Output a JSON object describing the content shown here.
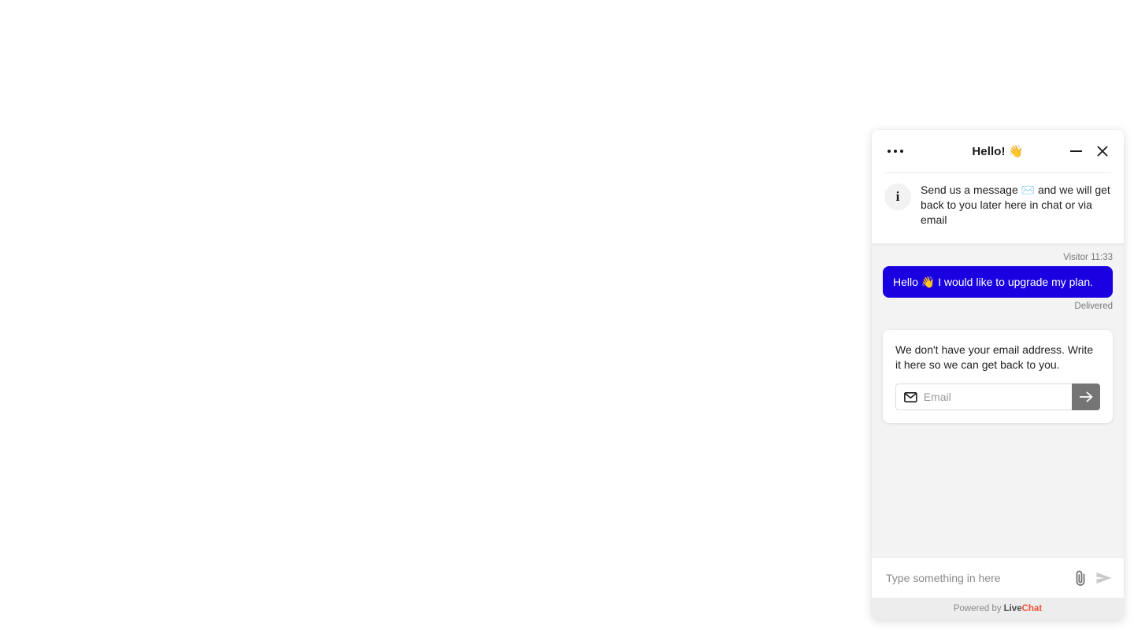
{
  "widget": {
    "header": {
      "title": "Hello! 👋",
      "menu_icon": "ellipsis-icon",
      "minimize_icon": "minimize-icon",
      "close_icon": "close-icon"
    },
    "intro": {
      "avatar_glyph": "i",
      "text": "Send us a message ✉️ and we will get back to you later here in chat or via email"
    },
    "conversation": {
      "messages": [
        {
          "author_time": "Visitor 11:33",
          "text": "Hello 👋 I would like to upgrade my plan.",
          "status": "Delivered",
          "bubble_color": "#1a00e0"
        }
      ],
      "email_card": {
        "text": "We don't have your email address. Write it here so we can get back to you.",
        "input_value": "",
        "input_placeholder": "Email",
        "envelope_icon": "envelope-icon",
        "submit_icon": "arrow-right-icon",
        "submit_color": "#757575"
      }
    },
    "composer": {
      "input_value": "",
      "input_placeholder": "Type something in here",
      "attach_icon": "paperclip-icon",
      "send_icon": "send-icon"
    },
    "footer": {
      "powered_by": "Powered by",
      "brand_first": "Live",
      "brand_second": "Chat"
    }
  }
}
